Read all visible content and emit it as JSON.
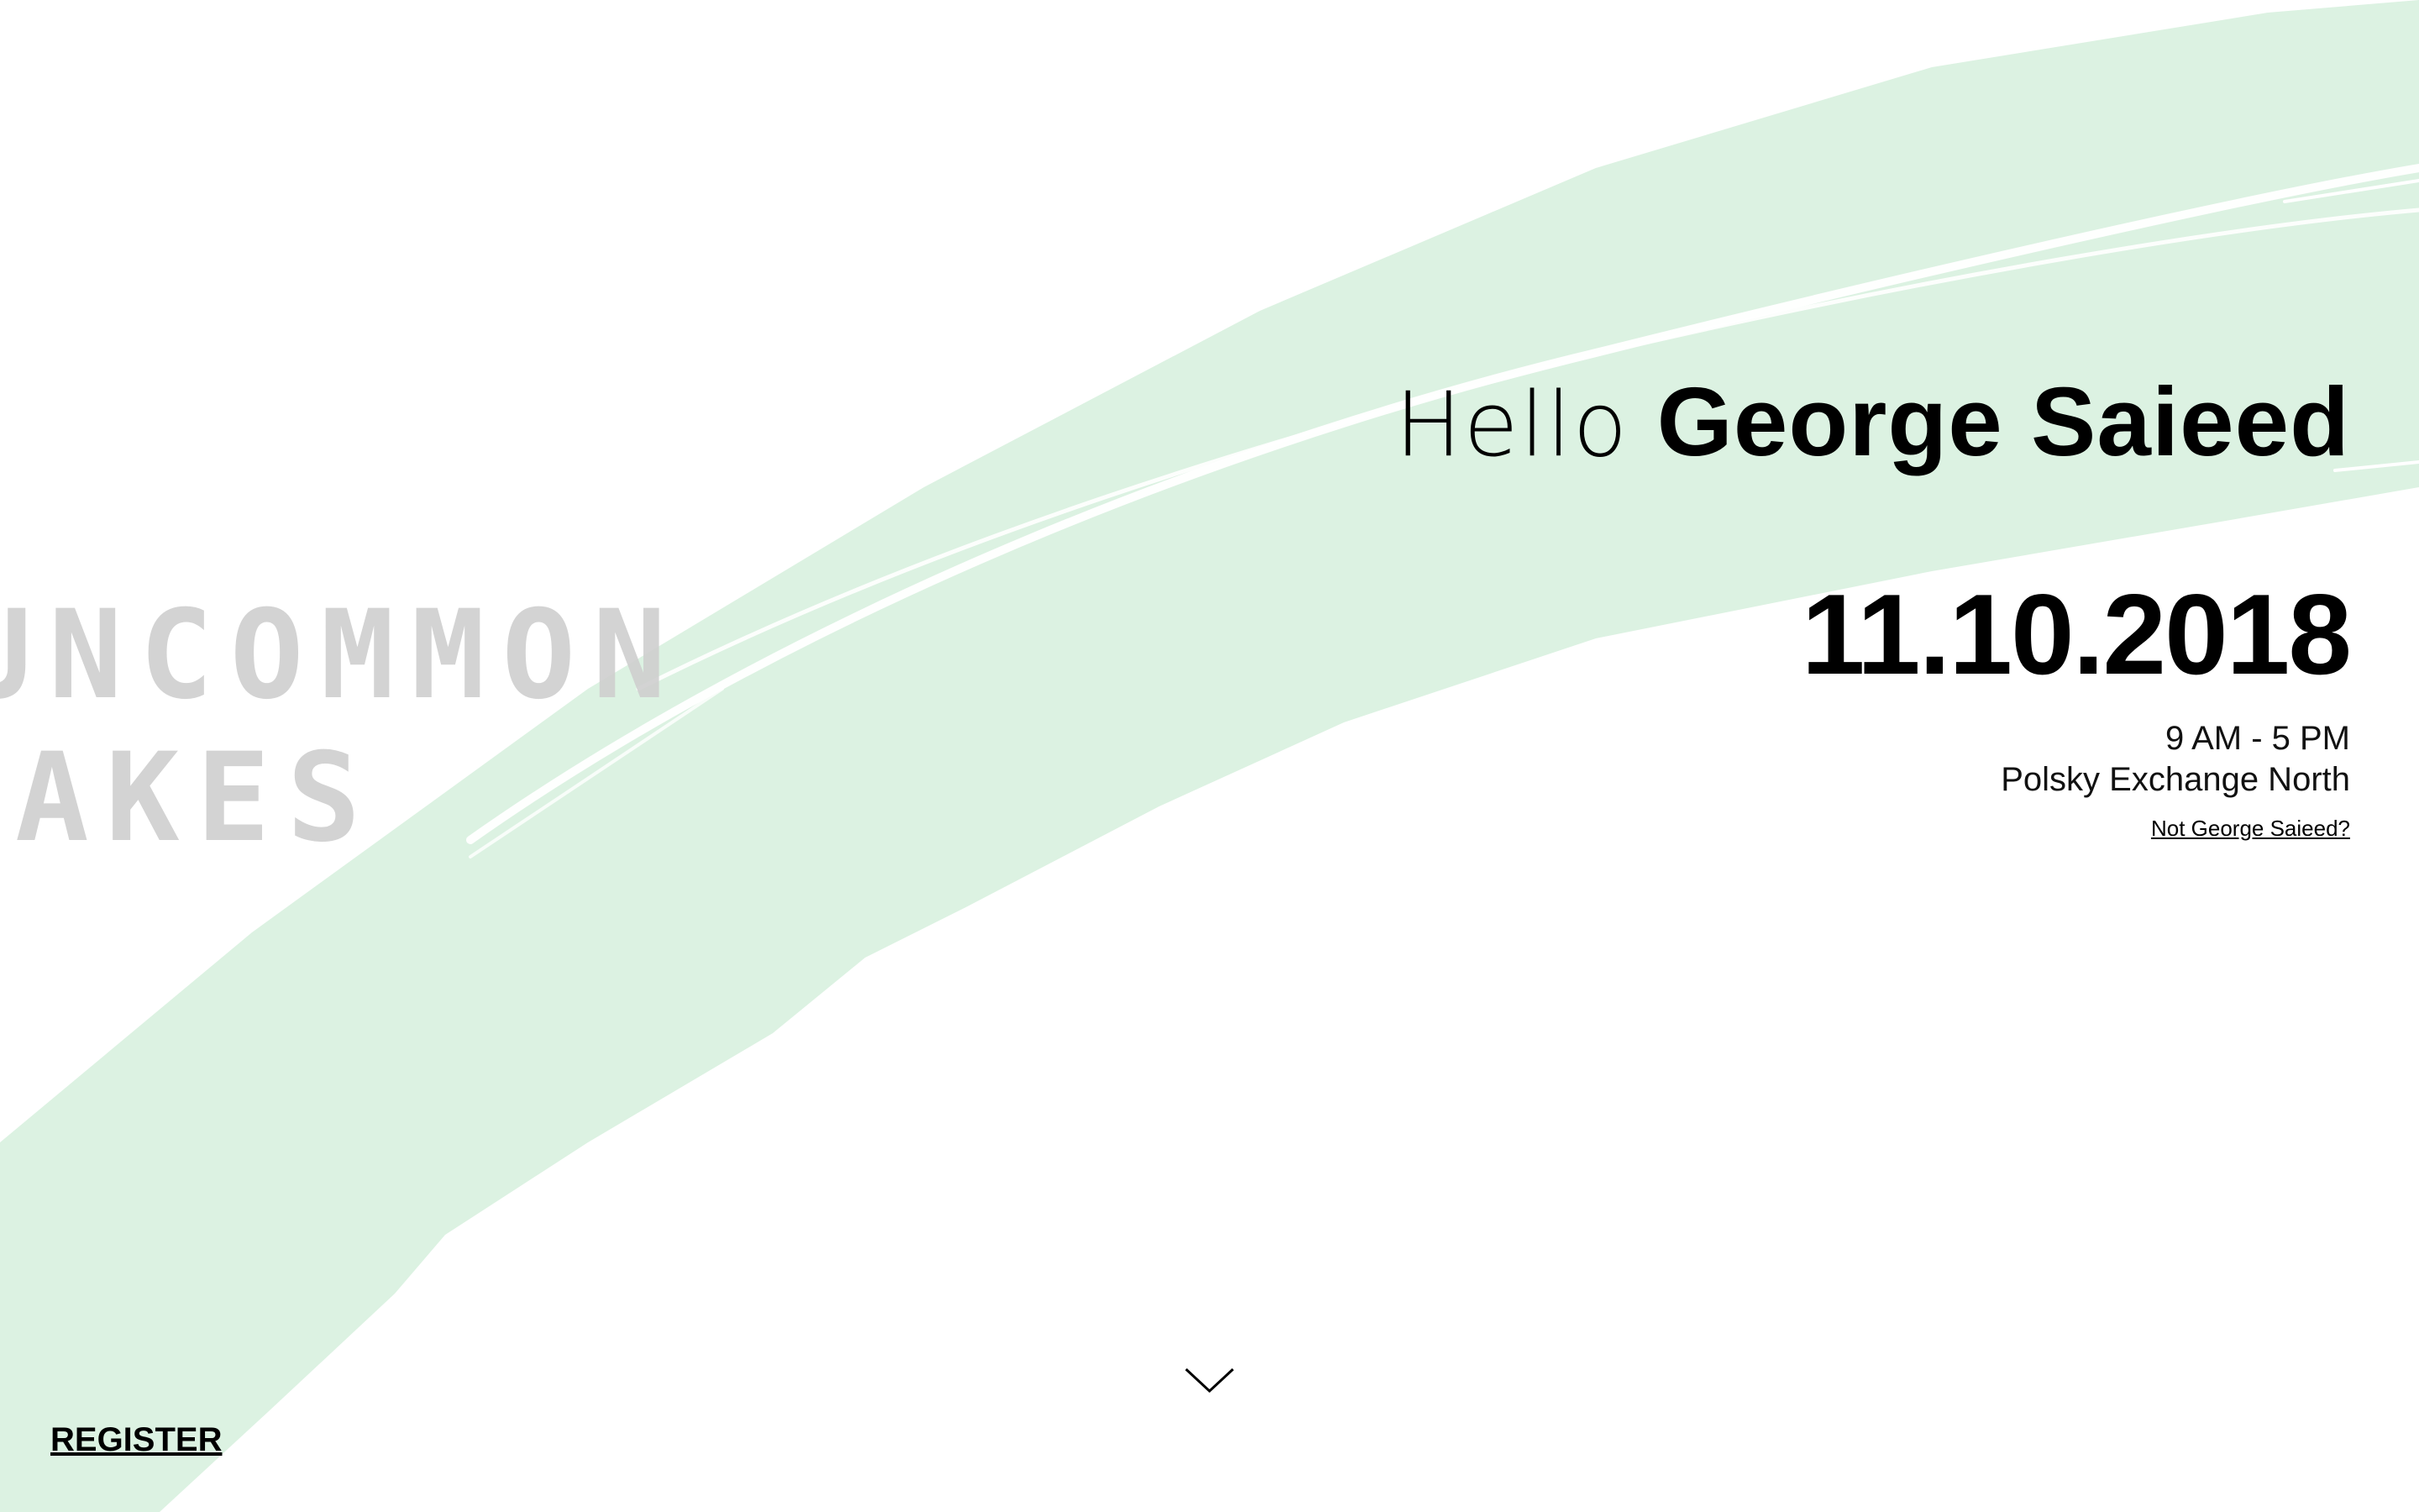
{
  "colors": {
    "background": "#ffffff",
    "brush_stroke": "#dcf2e2",
    "logo_text": "#cfcfcf",
    "text": "#000000"
  },
  "logo": {
    "line1": "UNCOMMON",
    "line2": "MAKES"
  },
  "greeting": {
    "hello": "Hello",
    "name": "George Saieed"
  },
  "event": {
    "date": "11.10.2018",
    "time": "9 AM - 5 PM",
    "location": "Polsky Exchange North"
  },
  "links": {
    "not_user": "Not George Saieed?",
    "register": "REGISTER"
  },
  "icons": {
    "scroll_down": "chevron-down-icon"
  }
}
